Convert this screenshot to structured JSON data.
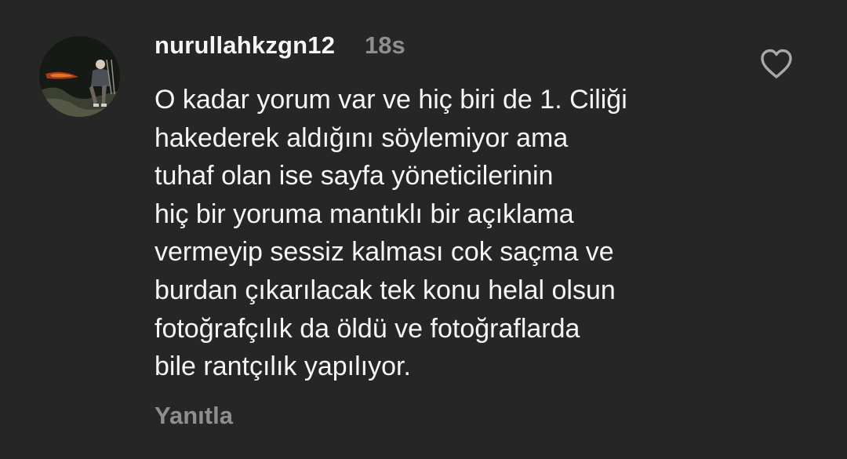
{
  "comment": {
    "username": "nurullahkzgn12",
    "timestamp": "18s",
    "text": "O kadar yorum var ve hiç biri de 1. Ciliği\nhakederek aldığını söylemiyor ama\ntuhaf olan ise sayfa yöneticilerinin\nhiç bir yoruma mantıklı bir açıklama\nvermeyip sessiz kalması cok saçma ve\nburdan çıkarılacak tek konu helal olsun\nfotoğrafçılık da öldü ve fotoğraflarda\nbile rantçılık yapılıyor.",
    "reply_label": "Yanıtla",
    "liked": false
  },
  "icons": {
    "like": "heart-outline-icon",
    "avatar": "profile-photo"
  },
  "colors": {
    "background": "#262626",
    "primary_text": "#f5f5f5",
    "secondary_text": "#8e8e8e",
    "icon": "#a8a8a8"
  }
}
